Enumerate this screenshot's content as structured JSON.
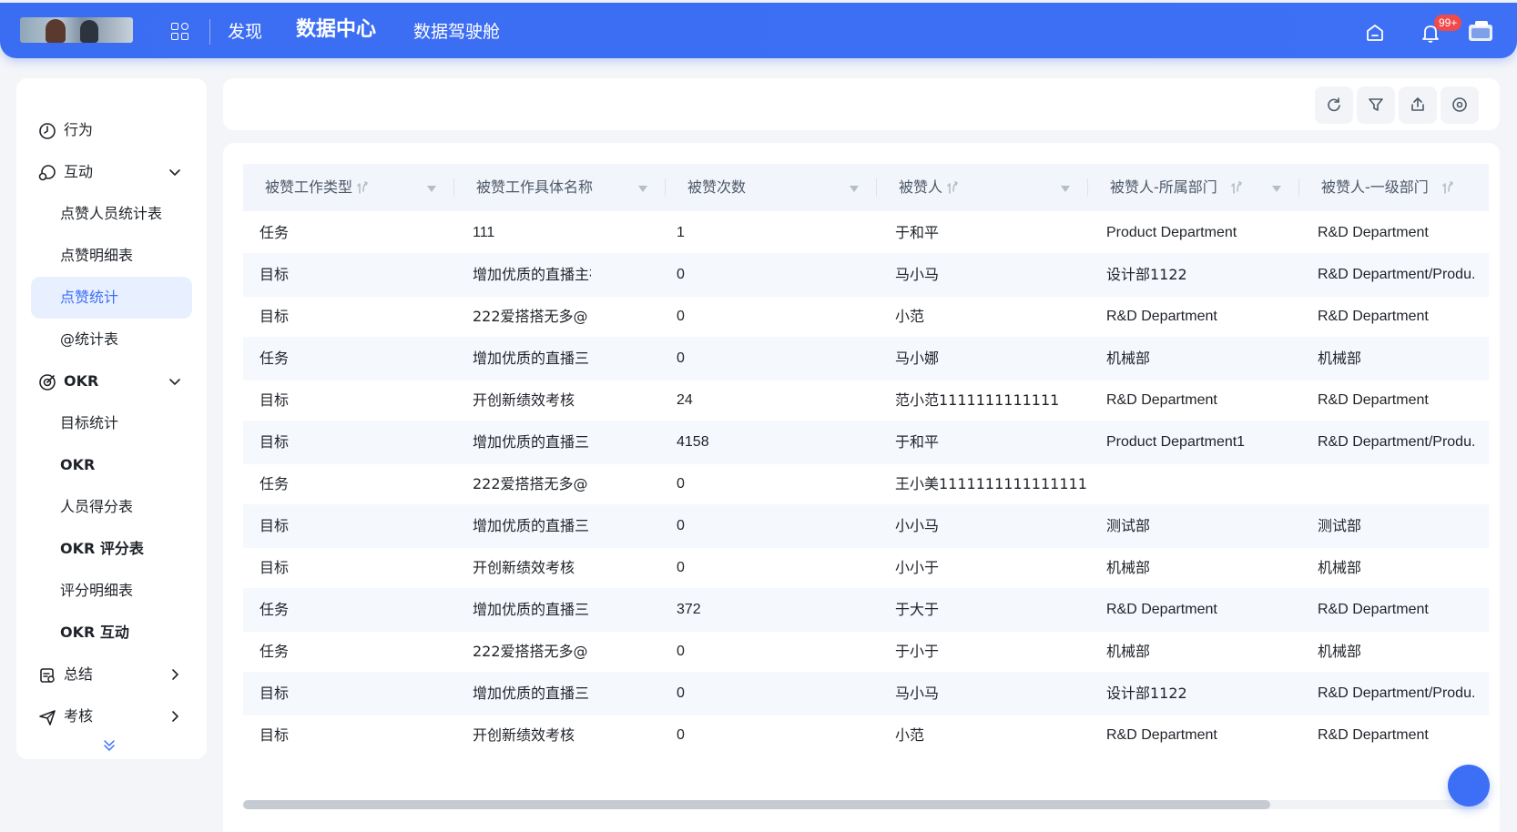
{
  "topbar": {
    "nav": [
      "发现",
      "数据中心",
      "数据驾驶舱"
    ],
    "active_nav": "数据中心",
    "notification_badge": "99+",
    "icons": [
      "apps-grid-icon",
      "home-icon",
      "bell-icon",
      "user-avatar"
    ]
  },
  "sidebar": {
    "behavior": "行为",
    "interaction": "互动",
    "interaction_items": [
      "点赞人员统计表",
      "点赞明细表",
      "点赞统计",
      "@统计表"
    ],
    "okr": "OKR",
    "okr_items": [
      "目标统计",
      "OKR",
      "人员得分表",
      "OKR 评分表",
      "评分明细表",
      "OKR 互动"
    ],
    "summary": "总结",
    "assessment": "考核",
    "active_item": "点赞统计"
  },
  "toolbar": {
    "icons": [
      "refresh-icon",
      "filter-icon",
      "export-icon",
      "settings-icon"
    ]
  },
  "table": {
    "columns": [
      "被赞工作类型",
      "被赞工作具体名称",
      "被赞次数",
      "被赞人",
      "被赞人-所属部门",
      "被赞人-一级部门"
    ],
    "rows": [
      [
        "任务",
        "111",
        "1",
        "于和平",
        "Product Department",
        "R&D Department"
      ],
      [
        "目标",
        "增加优质的直播主布",
        "0",
        "马小马",
        "设计部1122",
        "R&D Department/Produ."
      ],
      [
        "目标",
        "222爱搭搭无多@",
        "0",
        "小范",
        "R&D Department",
        "R&D Department"
      ],
      [
        "任务",
        "增加优质的直播三",
        "0",
        "马小娜",
        "机械部",
        "机械部"
      ],
      [
        "目标",
        "开创新绩效考核",
        "24",
        "范小范1111111111111",
        "R&D Department",
        "R&D Department"
      ],
      [
        "目标",
        "增加优质的直播三",
        "4158",
        "于和平",
        "Product Department1",
        "R&D Department/Produ."
      ],
      [
        "任务",
        "222爱搭搭无多@",
        "0",
        "王小美1111111111111111…",
        "",
        ""
      ],
      [
        "目标",
        "增加优质的直播三",
        "0",
        "小小马",
        "测试部",
        "测试部"
      ],
      [
        "目标",
        "开创新绩效考核",
        "0",
        "小小于",
        "机械部",
        "机械部"
      ],
      [
        "任务",
        "增加优质的直播三",
        "372",
        "于大于",
        "R&D Department",
        "R&D Department"
      ],
      [
        "任务",
        "222爱搭搭无多@",
        "0",
        "于小于",
        "机械部",
        "机械部"
      ],
      [
        "目标",
        "增加优质的直播三",
        "0",
        "马小马",
        "设计部1122",
        "R&D Department/Produ."
      ],
      [
        "目标",
        "开创新绩效考核",
        "0",
        "小范",
        "R&D Department",
        "R&D Department"
      ]
    ]
  },
  "colors": {
    "primary": "#3c6ff5",
    "active_bg": "#e8efff",
    "header_bg": "#f2f5fb",
    "badge": "#f24a4a"
  }
}
